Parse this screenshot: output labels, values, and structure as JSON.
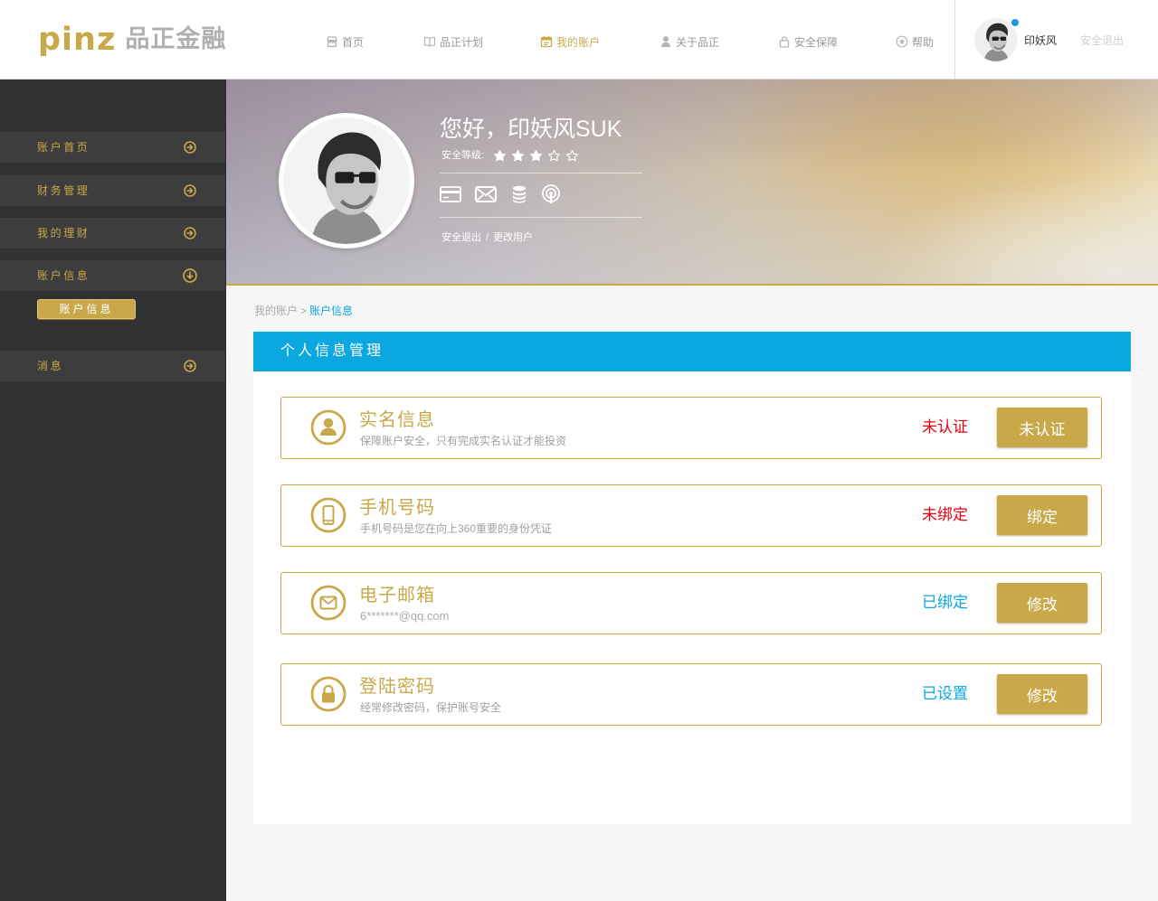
{
  "header": {
    "logo_latin": "pinz",
    "logo_cn": "品正金融",
    "nav": [
      {
        "label": "首页",
        "icon": "home-icon",
        "active": false
      },
      {
        "label": "品正计划",
        "icon": "book-icon",
        "active": false
      },
      {
        "label": "我的账户",
        "icon": "calendar-icon",
        "active": true
      },
      {
        "label": "关于品正",
        "icon": "user-icon",
        "active": false
      },
      {
        "label": "安全保障",
        "icon": "lock-icon",
        "active": false
      },
      {
        "label": "帮助",
        "icon": "help-icon",
        "active": false
      }
    ],
    "user_name": "印妖风",
    "notification_dot": true,
    "logout": "安全退出"
  },
  "sidebar": {
    "items": [
      {
        "label": "账户首页",
        "icon": "circle-arrow-right-icon"
      },
      {
        "label": "财务管理",
        "icon": "circle-arrow-right-icon"
      },
      {
        "label": "我的理财",
        "icon": "circle-arrow-right-icon"
      },
      {
        "label": "账户信息",
        "icon": "circle-arrow-down-icon",
        "expanded": true,
        "sub_items": [
          {
            "label": "账户信息",
            "active": true
          }
        ]
      },
      {
        "label": "消息",
        "icon": "circle-arrow-right-icon"
      }
    ]
  },
  "banner": {
    "greeting": "您好，印妖风SUK",
    "security_label": "安全等级:",
    "security_level": 3,
    "security_max": 5,
    "icons": [
      "bank-card-icon",
      "mail-icon",
      "coins-icon",
      "signal-icon"
    ],
    "logout": "安全退出",
    "separator": "/",
    "switch_user": "更改用户"
  },
  "breadcrumb": {
    "parent": "我的账户",
    "separator": ">",
    "current": "账户信息"
  },
  "panel": {
    "title": "个人信息管理",
    "cards": [
      {
        "icon": "user-icon",
        "title": "实名信息",
        "desc": "保障账户安全，只有完成实名认证才能投资",
        "status": "未认证",
        "status_color": "#e60012",
        "action": "未认证"
      },
      {
        "icon": "phone-icon",
        "title": "手机号码",
        "desc": "手机号码是您在向上360重要的身份凭证",
        "status": "未绑定",
        "status_color": "#e60012",
        "action": "绑定"
      },
      {
        "icon": "mail-icon",
        "title": "电子邮箱",
        "desc": "6*******@qq.com",
        "status": "已绑定",
        "status_color": "#0ba7e1",
        "action": "修改"
      },
      {
        "icon": "lock-icon",
        "title": "登陆密码",
        "desc": "经常修改密码，保护账号安全",
        "status": "已设置",
        "status_color": "#0ba7e1",
        "action": "修改"
      }
    ]
  },
  "colors": {
    "gold": "#c9a84a",
    "blue": "#0ba7e1",
    "red": "#e60012",
    "sidebar": "#323232"
  }
}
